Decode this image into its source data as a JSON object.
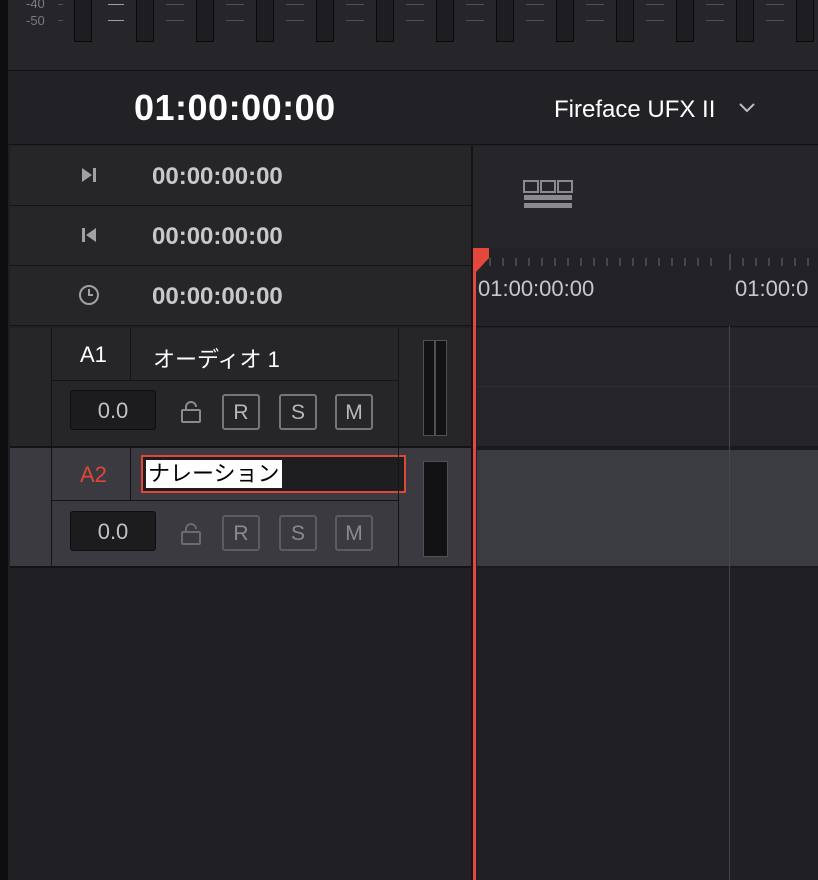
{
  "meters": {
    "db_labels": [
      "-40",
      "-50"
    ]
  },
  "transport": {
    "timecode": "01:00:00:00",
    "device": "Fireface UFX II"
  },
  "timecodes": {
    "mark_out": "00:00:00:00",
    "mark_in": "00:00:00:00",
    "duration": "00:00:00:00"
  },
  "ruler": {
    "labels": [
      "01:00:00:00",
      "01:00:0"
    ]
  },
  "tracks": [
    {
      "id": "A1",
      "name": "オーディオ 1",
      "volume": "0.0",
      "buttons": [
        "R",
        "S",
        "M"
      ],
      "editing": false
    },
    {
      "id": "A2",
      "name": "ナレーション",
      "volume": "0.0",
      "buttons": [
        "R",
        "S",
        "M"
      ],
      "editing": true
    }
  ],
  "colors": {
    "accent_red": "#e4473c",
    "track_green": "#3da05b",
    "selected_track_id": "#e0463a"
  },
  "icons": {
    "mark_out": "skip-to-end-icon",
    "mark_in": "skip-to-start-icon",
    "duration": "clock-icon",
    "device": "chevron-down-icon",
    "layout": "timeline-layout-icon",
    "lock": "lock-icon"
  }
}
